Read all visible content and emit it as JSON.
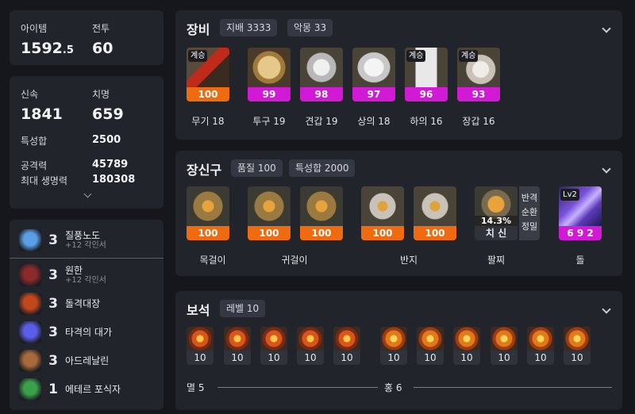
{
  "summary": {
    "item_level_label": "아이템",
    "item_level_value": "1592",
    "item_level_decimal": ".5",
    "combat_label": "전투",
    "combat_value": "60"
  },
  "stats": {
    "swiftness_label": "신속",
    "swiftness_value": "1841",
    "crit_label": "치명",
    "crit_value": "659",
    "stat_sum_label": "특성합",
    "stat_sum_value": "2500",
    "attack_label": "공격력",
    "attack_value": "45789",
    "hp_label": "최대 생명력",
    "hp_value": "180308"
  },
  "engravings": [
    {
      "level": "3",
      "name": "질풍노도",
      "sub": "+12 각인서",
      "icon": "wind-icon",
      "color": "#5aa0e8"
    },
    {
      "level": "3",
      "name": "원한",
      "sub": "+12 각인서",
      "icon": "grudge-icon",
      "color": "#8a2a2a"
    },
    {
      "level": "3",
      "name": "돌격대장",
      "sub": "",
      "icon": "raid-captain-icon",
      "color": "#c2481c"
    },
    {
      "level": "3",
      "name": "타격의 대가",
      "sub": "",
      "icon": "hit-master-icon",
      "color": "#5a5ee8"
    },
    {
      "level": "3",
      "name": "아드레날린",
      "sub": "",
      "icon": "adrenaline-icon",
      "color": "#a86a3a"
    },
    {
      "level": "1",
      "name": "에테르 포식자",
      "sub": "",
      "icon": "ether-predator-icon",
      "color": "#3aa04a"
    }
  ],
  "equipment": {
    "title": "장비",
    "badge1": "지배 3333",
    "badge2": "악몽 33",
    "inherit_tag": "계승",
    "items": [
      {
        "quality": "100",
        "label": "무기 18",
        "icon": "weapon-scythe-icon"
      },
      {
        "quality": "99",
        "label": "투구 19",
        "icon": "helmet-icon"
      },
      {
        "quality": "98",
        "label": "견갑 19",
        "icon": "shoulder-icon"
      },
      {
        "quality": "97",
        "label": "상의 18",
        "icon": "chest-armor-icon"
      },
      {
        "quality": "96",
        "label": "하의 16",
        "icon": "pants-icon"
      },
      {
        "quality": "93",
        "label": "장갑 16",
        "icon": "gloves-icon"
      }
    ]
  },
  "accessories": {
    "title": "장신구",
    "badge1": "품질 100",
    "badge2": "특성합 2000",
    "items": [
      {
        "quality": "100",
        "icon": "necklace-icon"
      },
      {
        "quality": "100",
        "icon": "earring-icon"
      },
      {
        "quality": "100",
        "icon": "earring-icon"
      },
      {
        "quality": "100",
        "icon": "ring-icon"
      },
      {
        "quality": "100",
        "icon": "ring-icon"
      }
    ],
    "labels": {
      "necklace": "목걸이",
      "earring": "귀걸이",
      "ring": "반지",
      "bracelet": "팔찌",
      "stone": "돌"
    },
    "bracelet": {
      "percent": "14.3%",
      "stats": "치 신",
      "effects": [
        "반격",
        "순환",
        "정밀"
      ],
      "icon": "bracelet-icon"
    },
    "stone": {
      "level": "Lv2",
      "value": "6 9 2",
      "icon": "ability-stone-icon"
    }
  },
  "gems": {
    "title": "보석",
    "badge": "레벨 10",
    "group1_label": "멸 5",
    "group2_label": "홍 6",
    "group1": [
      "10",
      "10",
      "10",
      "10",
      "10"
    ],
    "group2": [
      "10",
      "10",
      "10",
      "10",
      "10",
      "10"
    ]
  },
  "colors": {
    "quality_orange": "#f06a0f",
    "quality_pink": "#d21ad6",
    "panel": "#21242b",
    "background": "#15171c"
  }
}
